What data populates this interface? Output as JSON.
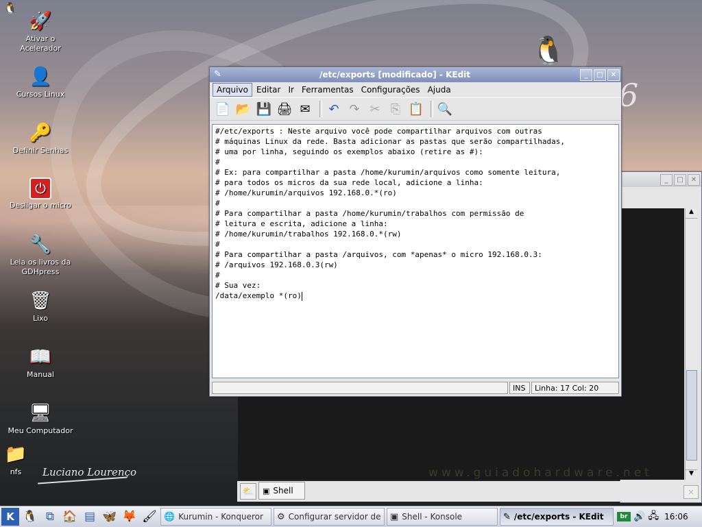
{
  "desktop": {
    "icons": [
      {
        "label": "Ativar o\nAcelerador",
        "icon": "rocket-icon",
        "glyph": "🚀"
      },
      {
        "label": "Cursos Linux",
        "icon": "user-icon",
        "glyph": "👤"
      },
      {
        "label": "Definir Senhas",
        "icon": "keys-icon",
        "glyph": "🔑"
      },
      {
        "label": "Desligar o micro",
        "icon": "power-icon",
        "glyph": "⏻"
      },
      {
        "label": "Leia os livros da\nGDHpress",
        "icon": "tools-icon",
        "glyph": "🔧"
      },
      {
        "label": "Lixo",
        "icon": "trash-icon",
        "glyph": "🗑"
      },
      {
        "label": "Manual",
        "icon": "book-icon",
        "glyph": "📖"
      },
      {
        "label": "Meu Computador",
        "icon": "computer-icon",
        "glyph": "🖥"
      },
      {
        "label": "nfs",
        "icon": "folder-icon",
        "glyph": "📁"
      }
    ],
    "signature": "Luciano Lourenço",
    "watermark_url": "www.guiadohardware.net"
  },
  "kedit": {
    "title": "/etc/exports [modificado] - KEdit",
    "menu": [
      "Arquivo",
      "Editar",
      "Ir",
      "Ferramentas",
      "Configurações",
      "Ajuda"
    ],
    "content": "#/etc/exports : Neste arquivo você pode compartilhar arquivos com outras\n# máquinas Linux da rede. Basta adicionar as pastas que serão compartilhadas,\n# uma por linha, seguindo os exemplos abaixo (retire as #):\n#\n# Ex: para compartilhar a pasta /home/kurumin/arquivos como somente leitura,\n# para todos os micros da sua rede local, adicione a linha:\n# /home/kurumin/arquivos 192.168.0.*(ro)\n#\n# Para compartilhar a pasta /home/kurumin/trabalhos com permissão de\n# leitura e escrita, adicione a linha:\n# /home/kurumin/trabalhos 192.168.0.*(rw)\n#\n# Para compartilhar a pasta /arquivos, com *apenas* o micro 192.168.0.3:\n# /arquivos 192.168.0.3(rw)\n#\n# Sua vez:\n/data/exemplo *(ro)",
    "status": {
      "mode": "INS",
      "position": "Linha: 17 Col: 20"
    }
  },
  "konsole": {
    "tab_label": "Shell"
  },
  "taskbar": {
    "tasks": [
      {
        "label": "Kurumin - Konqueror",
        "icon": "konqueror-icon"
      },
      {
        "label": "Configurar servidor de e",
        "icon": "config-icon"
      },
      {
        "label": "Shell - Konsole",
        "icon": "konsole-icon"
      },
      {
        "label": "/etc/exports - KEdit",
        "icon": "kedit-icon"
      }
    ],
    "tray_lang": "br",
    "clock": "16:06"
  }
}
